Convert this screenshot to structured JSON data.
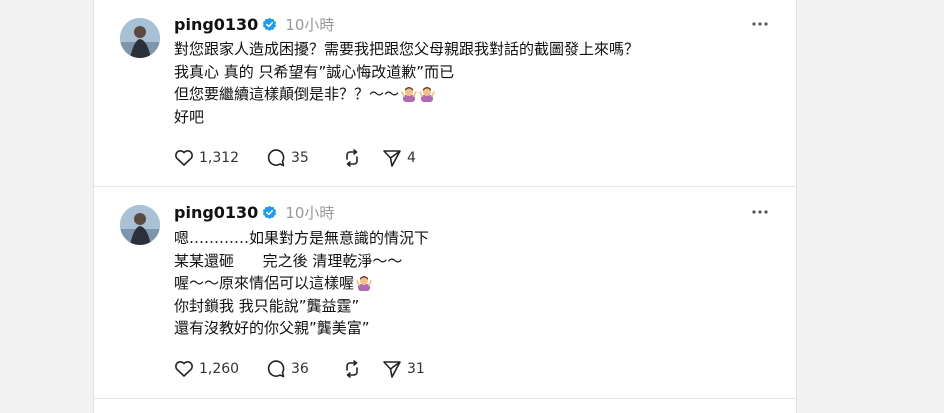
{
  "posts": [
    {
      "username": "ping0130",
      "timestamp": "10小時",
      "lines": [
        "對您跟家人造成困擾？需要我把跟您父母親跟我對話的截圖發上來嗎？",
        "我真心 真的 只希望有”誠心悔改道歉”而已",
        "但您要繼續這樣顛倒是非？？～～",
        "好吧"
      ],
      "likes": "1,312",
      "comments": "35",
      "shares": "4"
    },
    {
      "username": "ping0130",
      "timestamp": "10小時",
      "lines": [
        "嗯…………如果對方是無意識的情況下",
        "某某還砸      完之後 清理乾淨～～",
        "喔～～原來情侶可以這樣喔",
        "你封鎖我 我只能說”龔益霆”",
        "還有沒教好的你父親”龔美富”"
      ],
      "likes": "1,260",
      "comments": "36",
      "shares": "31"
    }
  ],
  "icons": {
    "verified": "verified-badge-icon",
    "more": "more-options-icon",
    "like": "heart-icon",
    "comment": "comment-icon",
    "repost": "repost-icon",
    "share": "send-icon",
    "emoji": "person-shrugging-emoji-icon"
  },
  "colors": {
    "verified": "#1d9bf0",
    "emoji": "#b06ab3"
  }
}
